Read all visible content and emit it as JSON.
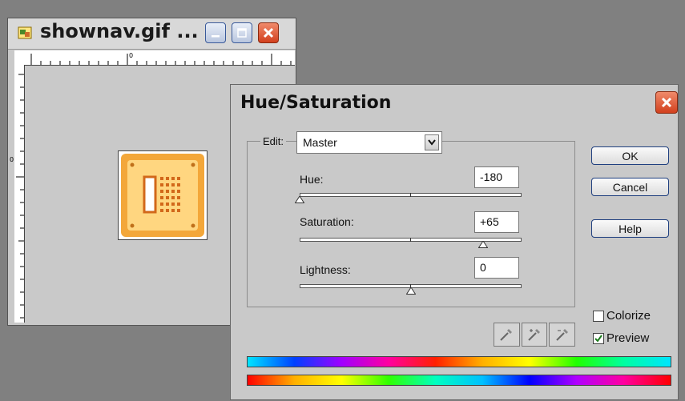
{
  "document_window": {
    "title": "shownav.gif ...",
    "ruler_zero": "0"
  },
  "dialog": {
    "title": "Hue/Saturation",
    "edit_label": "Edit:",
    "edit_value": "Master",
    "hue": {
      "label": "Hue:",
      "value": "-180",
      "slider_fraction": 0.0
    },
    "saturation": {
      "label": "Saturation:",
      "value": "+65",
      "slider_fraction": 0.825
    },
    "lightness": {
      "label": "Lightness:",
      "value": "0",
      "slider_fraction": 0.5
    },
    "buttons": {
      "ok": "OK",
      "cancel": "Cancel",
      "help": "Help"
    },
    "colorize": {
      "label": "Colorize",
      "checked": false
    },
    "preview": {
      "label": "Preview",
      "checked": true
    },
    "eyedroppers": [
      "eyedropper-icon",
      "eyedropper-plus-icon",
      "eyedropper-minus-icon"
    ]
  },
  "colors": {
    "accent": "#d2401e",
    "background": "#808080",
    "panel": "#c9c9c9",
    "thumbnail_orange": "#f3a73a"
  }
}
